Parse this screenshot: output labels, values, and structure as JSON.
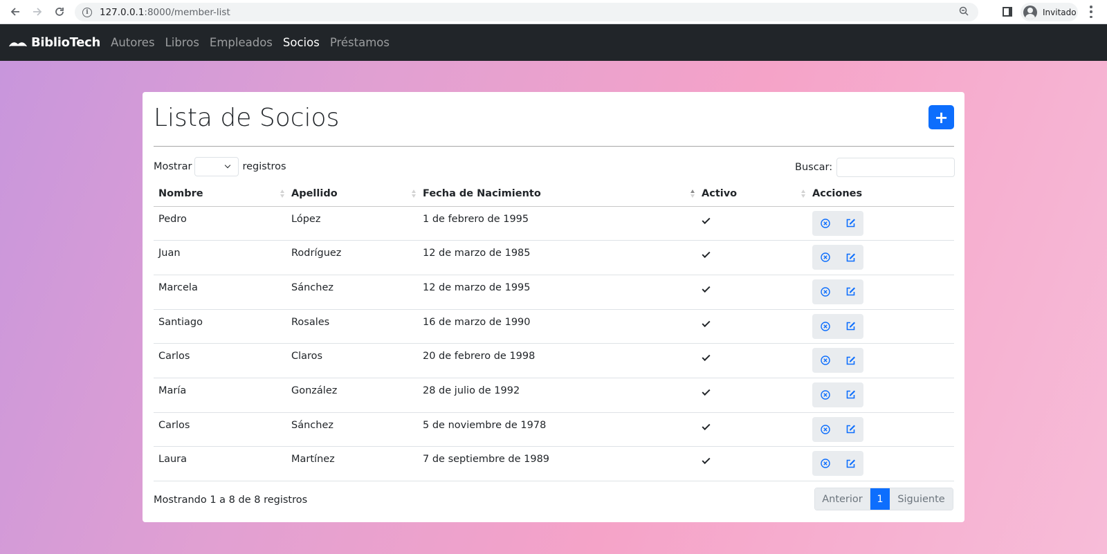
{
  "browser": {
    "url_host": "127.0.0.1",
    "url_path": ":8000/member-list",
    "profile_label": "Invitado"
  },
  "navbar": {
    "brand": "BiblioTech",
    "links": [
      "Autores",
      "Libros",
      "Empleados",
      "Socios",
      "Préstamos"
    ],
    "active_link": "Socios"
  },
  "page": {
    "title": "Lista de Socios",
    "add_button": "+",
    "length_prefix": "Mostrar",
    "length_suffix": "registros",
    "search_label": "Buscar:"
  },
  "table": {
    "columns": [
      "Nombre",
      "Apellido",
      "Fecha de Nacimiento",
      "Activo",
      "Acciones"
    ],
    "sorted_column": "Fecha de Nacimiento",
    "rows": [
      {
        "nombre": "Pedro",
        "apellido": "López",
        "fecha": "1 de febrero de 1995",
        "activo": true
      },
      {
        "nombre": "Juan",
        "apellido": "Rodríguez",
        "fecha": "12 de marzo de 1985",
        "activo": true
      },
      {
        "nombre": "Marcela",
        "apellido": "Sánchez",
        "fecha": "12 de marzo de 1995",
        "activo": true
      },
      {
        "nombre": "Santiago",
        "apellido": "Rosales",
        "fecha": "16 de marzo de 1990",
        "activo": true
      },
      {
        "nombre": "Carlos",
        "apellido": "Claros",
        "fecha": "20 de febrero de 1998",
        "activo": true
      },
      {
        "nombre": "María",
        "apellido": "González",
        "fecha": "28 de julio de 1992",
        "activo": true
      },
      {
        "nombre": "Carlos",
        "apellido": "Sánchez",
        "fecha": "5 de noviembre de 1978",
        "activo": true
      },
      {
        "nombre": "Laura",
        "apellido": "Martínez",
        "fecha": "7 de septiembre de 1989",
        "activo": true
      }
    ]
  },
  "footer": {
    "info": "Mostrando 1 a 8 de 8 registros",
    "prev": "Anterior",
    "current_page": "1",
    "next": "Siguiente"
  },
  "colors": {
    "accent": "#0d6efd",
    "navbar": "#212529"
  },
  "icons": {
    "delete": "circle-x-icon",
    "edit": "edit-icon"
  }
}
